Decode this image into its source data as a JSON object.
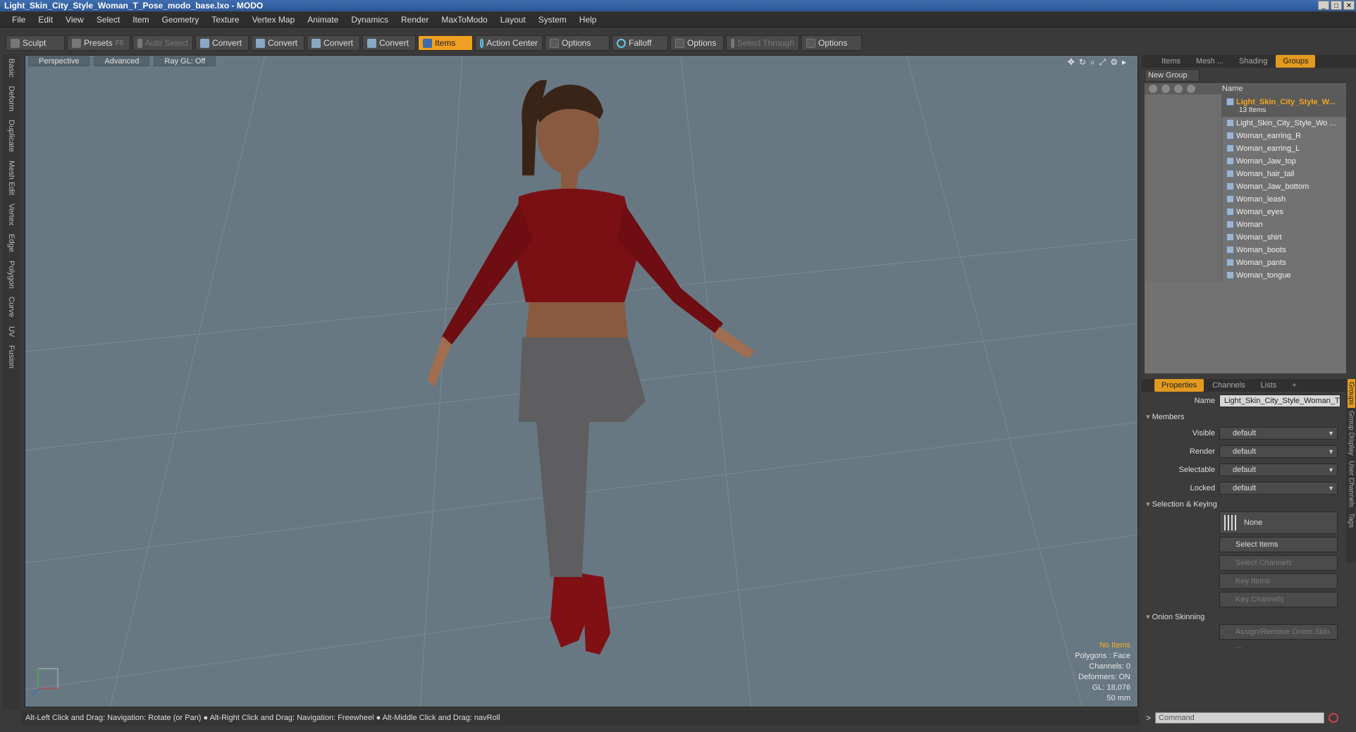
{
  "window": {
    "title": "Light_Skin_City_Style_Woman_T_Pose_modo_base.lxo - MODO"
  },
  "menu": [
    "File",
    "Edit",
    "View",
    "Select",
    "Item",
    "Geometry",
    "Texture",
    "Vertex Map",
    "Animate",
    "Dynamics",
    "Render",
    "MaxToModo",
    "Layout",
    "System",
    "Help"
  ],
  "toolbar": {
    "sculpt": "Sculpt",
    "presets": "Presets",
    "presets_key": "F6",
    "auto_select": "Auto Select",
    "convert1": "Convert",
    "convert2": "Convert",
    "convert3": "Convert",
    "convert4": "Convert",
    "items": "Items",
    "action_center": "Action Center",
    "options1": "Options",
    "falloff": "Falloff",
    "options2": "Options",
    "select_through": "Select Through",
    "options3": "Options"
  },
  "left_tabs": [
    "Basic",
    "Deform",
    "Duplicate",
    "Mesh Edit",
    "Vertex",
    "Edge",
    "Polygon",
    "Curve",
    "UV",
    "Fusion"
  ],
  "viewport": {
    "view": "Perspective",
    "shading": "Advanced",
    "raygl": "Ray GL: Off",
    "info": {
      "selection": "No Items",
      "polygons": "Polygons : Face",
      "channels": "Channels: 0",
      "deformers": "Deformers: ON",
      "gl": "GL: 18,076",
      "size": "50 mm"
    }
  },
  "statusbar": "Alt-Left Click and Drag: Navigation: Rotate (or Pan) ● Alt-Right Click and Drag: Navigation: Freewheel ● Alt-Middle Click and Drag: navRoll",
  "right_tabs": [
    "Items",
    "Mesh ...",
    "Shading",
    "Groups"
  ],
  "groups": {
    "new_group": "New Group",
    "header_name": "Name",
    "group_name": "Light_Skin_City_Style_W...",
    "group_count": "13 Items",
    "items": [
      "Light_Skin_City_Style_Wo ...",
      "Woman_earring_R",
      "Woman_earring_L",
      "Woman_Jaw_top",
      "Woman_hair_tail",
      "Woman_Jaw_bottom",
      "Woman_leash",
      "Woman_eyes",
      "Woman",
      "Woman_shirt",
      "Woman_boots",
      "Woman_pants",
      "Woman_tongue"
    ]
  },
  "properties": {
    "tabs": [
      "Properties",
      "Channels",
      "Lists",
      "+"
    ],
    "name_label": "Name",
    "name_value": "Light_Skin_City_Style_Woman_T",
    "members": "Members",
    "visible_label": "Visible",
    "visible_value": "default",
    "render_label": "Render",
    "render_value": "default",
    "selectable_label": "Selectable",
    "selectable_value": "default",
    "locked_label": "Locked",
    "locked_value": "default",
    "selection_keying": "Selection & Keying",
    "none_btn": "None",
    "select_items": "Select Items",
    "select_channels": "Select Channels",
    "key_items": "Key Items",
    "key_channels": "Key Channels",
    "onion": "Onion Skinning",
    "onion_btn": "Assign/Remove Onion Skin ...",
    "side_tabs": [
      "Groups",
      "Group Display",
      "User Channels",
      "Tags"
    ]
  },
  "command": {
    "placeholder": "Command",
    "prompt": ">"
  }
}
